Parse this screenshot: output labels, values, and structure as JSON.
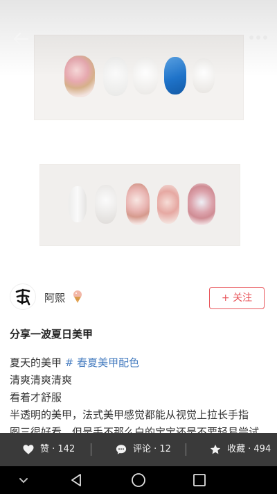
{
  "header": {
    "back_icon": "arrow-left-icon",
    "more_icon": "more-dots-icon"
  },
  "author": {
    "name": "阿熙",
    "emoji_icon": "ice-cream-icon",
    "follow_label": "+ 关注"
  },
  "post": {
    "title": "分享一波夏日美甲",
    "line1_text": "夏天的美甲",
    "line1_tag": "# 春夏美甲配色",
    "line2": "清爽清爽清爽",
    "line3": "看着才舒服",
    "line4": "半透明的美甲，法式美甲感觉都能从视觉上拉长手指",
    "line5": "图三很好看。但是手不那么白的宝宝还是不要轻易尝试"
  },
  "actions": {
    "like_label": "赞 · 142",
    "comment_label": "评论 · 12",
    "collect_label": "收藏 · 494"
  },
  "colors": {
    "accent": "#e8545a",
    "tag": "#4a7fc1",
    "action_bar": "#3a3a3a",
    "nail_blue": "#1f73c9"
  }
}
